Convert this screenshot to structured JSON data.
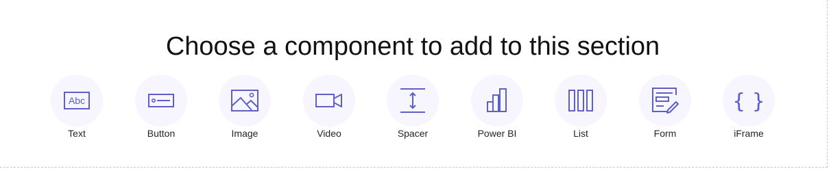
{
  "heading": "Choose a component to add to this section",
  "accent_color": "#5b5fc7",
  "components": [
    {
      "label": "Text",
      "icon": "text-abc-icon",
      "icon_text": "Abc"
    },
    {
      "label": "Button",
      "icon": "button-icon"
    },
    {
      "label": "Image",
      "icon": "image-icon"
    },
    {
      "label": "Video",
      "icon": "video-camera-icon"
    },
    {
      "label": "Spacer",
      "icon": "spacer-icon"
    },
    {
      "label": "Power BI",
      "icon": "power-bi-icon"
    },
    {
      "label": "List",
      "icon": "list-columns-icon"
    },
    {
      "label": "Form",
      "icon": "form-icon"
    },
    {
      "label": "iFrame",
      "icon": "iframe-braces-icon",
      "icon_text": "{ }"
    }
  ]
}
